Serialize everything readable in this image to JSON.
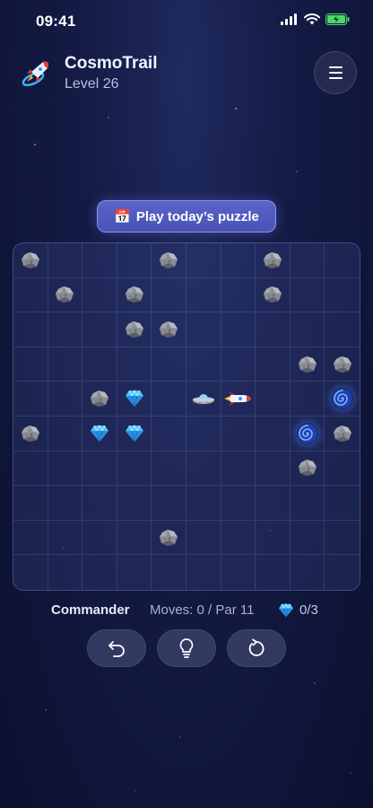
{
  "status_bar": {
    "time": "09:41"
  },
  "header": {
    "app_title": "CosmoTrail",
    "level": "Level 26"
  },
  "daily_button": {
    "icon": "📅",
    "label": "Play today’s puzzle"
  },
  "board": {
    "rows": 10,
    "cols": 10,
    "pieces": [
      {
        "type": "asteroid",
        "row": 0,
        "col": 0
      },
      {
        "type": "asteroid",
        "row": 0,
        "col": 4
      },
      {
        "type": "asteroid",
        "row": 0,
        "col": 7
      },
      {
        "type": "asteroid",
        "row": 1,
        "col": 1
      },
      {
        "type": "asteroid",
        "row": 1,
        "col": 3
      },
      {
        "type": "asteroid",
        "row": 1,
        "col": 7
      },
      {
        "type": "asteroid",
        "row": 2,
        "col": 3
      },
      {
        "type": "asteroid",
        "row": 2,
        "col": 4
      },
      {
        "type": "asteroid",
        "row": 3,
        "col": 8
      },
      {
        "type": "asteroid",
        "row": 3,
        "col": 9
      },
      {
        "type": "asteroid",
        "row": 4,
        "col": 2
      },
      {
        "type": "gem",
        "row": 4,
        "col": 3
      },
      {
        "type": "ufo",
        "row": 4,
        "col": 5
      },
      {
        "type": "rocket",
        "row": 4,
        "col": 6
      },
      {
        "type": "portal",
        "row": 4,
        "col": 9
      },
      {
        "type": "asteroid",
        "row": 5,
        "col": 0
      },
      {
        "type": "gem",
        "row": 5,
        "col": 2
      },
      {
        "type": "gem",
        "row": 5,
        "col": 3
      },
      {
        "type": "portal",
        "row": 5,
        "col": 8
      },
      {
        "type": "asteroid",
        "row": 5,
        "col": 9
      },
      {
        "type": "asteroid",
        "row": 6,
        "col": 8
      },
      {
        "type": "asteroid",
        "row": 8,
        "col": 4
      }
    ]
  },
  "info": {
    "player": "Commander",
    "moves": "Moves: 0 / Par 11",
    "gems": "0/3"
  },
  "controls": {
    "undo_icon": "undo-icon",
    "hint_icon": "lightbulb-icon",
    "restart_icon": "restart-icon"
  },
  "colors": {
    "background": "#141b45",
    "accent": "#5a63c9",
    "gem": "#5bc8ff",
    "portal": "#3b6cff"
  }
}
